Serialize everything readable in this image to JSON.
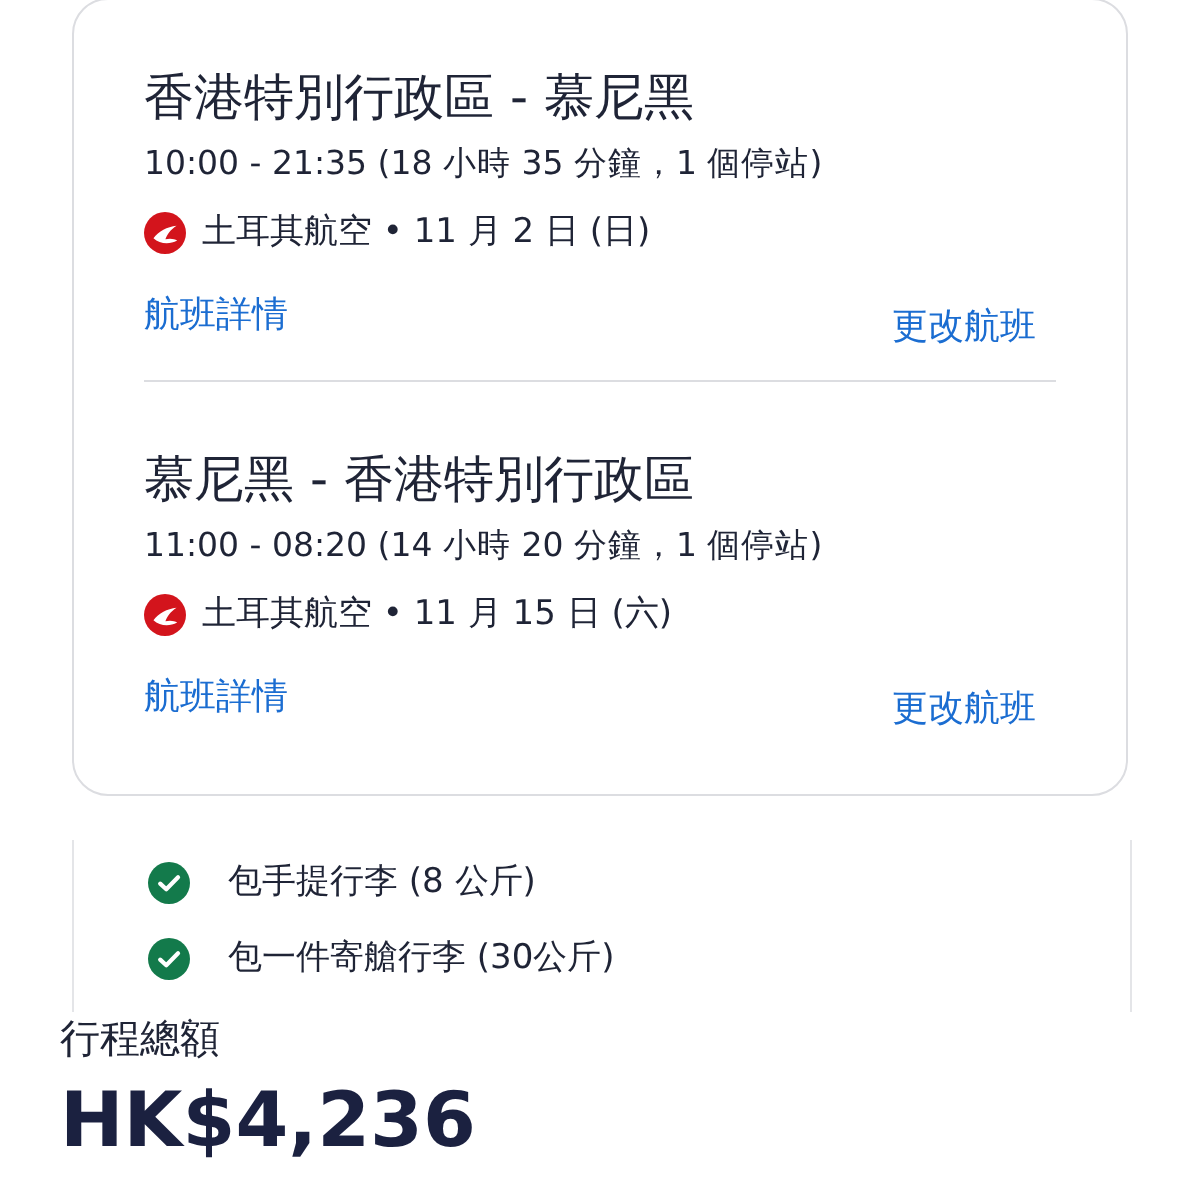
{
  "segments": [
    {
      "route": "香港特別行政區 - 慕尼黑",
      "times": "10:00 - 21:35 (18 小時 35 分鐘，1 個停站)",
      "airline": "土耳其航空 • 11 月 2 日 (日)",
      "details_link": "航班詳情",
      "change_link": "更改航班"
    },
    {
      "route": "慕尼黑 - 香港特別行政區",
      "times": "11:00 - 08:20 (14 小時 20 分鐘，1 個停站)",
      "airline": "土耳其航空 • 11 月 15 日 (六)",
      "details_link": "航班詳情",
      "change_link": "更改航班"
    }
  ],
  "baggage": [
    {
      "label": "包手提行李 (8 公斤)",
      "included": true
    },
    {
      "label": "包一件寄艙行李 (30公斤)",
      "included": true
    }
  ],
  "total": {
    "label": "行程總額",
    "amount": "HK$4,236"
  }
}
